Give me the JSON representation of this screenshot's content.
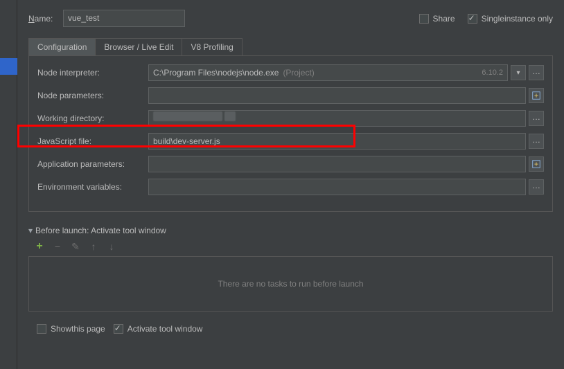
{
  "name": {
    "label_pre": "",
    "label_u": "N",
    "label_post": "ame:",
    "value": "vue_test"
  },
  "share": {
    "label_pre": "",
    "label_u": "S",
    "label_post": "hare",
    "checked": false
  },
  "single": {
    "label_pre": "Single ",
    "label_u": "i",
    "label_post": "nstance only",
    "checked": true
  },
  "tabs": {
    "t0": "Configuration",
    "t1": "Browser / Live Edit",
    "t2": "V8 Profiling",
    "active": 0
  },
  "fields": {
    "node_interpreter": {
      "label_pre": "Node ",
      "label_u": "i",
      "label_post": "nterpreter:",
      "value": "C:\\Program Files\\nodejs\\node.exe",
      "hint": "(Project)",
      "version": "6.10.2"
    },
    "node_parameters": {
      "label_pre": "Node ",
      "label_u": "p",
      "label_post": "arameters:",
      "value": ""
    },
    "working_dir": {
      "label_pre": "Working ",
      "label_u": "d",
      "label_post": "irectory:",
      "value": ""
    },
    "js_file": {
      "label_pre": "JavaScript ",
      "label_u": "f",
      "label_post": "ile:",
      "value": "build\\dev-server.js"
    },
    "app_params": {
      "label_pre": "",
      "label_u": "A",
      "label_post": "pplication parameters:",
      "value": ""
    },
    "env_vars": {
      "label_pre": "",
      "label_u": "E",
      "label_post": "nvironment variables:",
      "value": ""
    }
  },
  "before": {
    "title_pre": "Before launc",
    "title_u": "h",
    "title_post": ": Activate tool window",
    "empty": "There are no tasks to run before launch"
  },
  "bottom": {
    "show": {
      "label_pre": "Sho",
      "label_u": "w",
      "label_post": " this page",
      "checked": false
    },
    "activate": {
      "label_pre": "Activate tool windo",
      "label_u": "w",
      "label_post": "",
      "checked": true
    }
  }
}
